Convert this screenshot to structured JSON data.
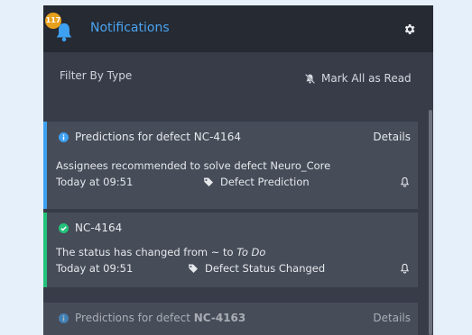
{
  "header": {
    "badge_count": "117",
    "title": "Notifications",
    "icons": {
      "bell": "bell-icon",
      "settings": "gear-icon"
    }
  },
  "filter": {
    "label": "Filter By Type",
    "mark_all_read": "Mark All as Read",
    "mark_all_icon": "bell-slash-icon"
  },
  "notifications": [
    {
      "title_prefix": "Predictions for defect",
      "title_id": "NC-4164",
      "details_label": "Details",
      "message": "Assignees recommended to solve defect Neuro_Core",
      "time": "Today at 09:51",
      "type": "Defect Prediction",
      "status_icon": "info-circle-icon",
      "accent": "#3ea0f0"
    },
    {
      "title_id": "NC-4164",
      "message_prefix": "The status has changed from ~ to",
      "message_emph": "To Do",
      "time": "Today at 09:51",
      "type": "Defect Status Changed",
      "status_icon": "check-circle-icon",
      "accent": "#23c27a"
    },
    {
      "title_prefix": "Predictions for defect",
      "title_id": "NC-4163",
      "details_label": "Details",
      "status_icon": "info-circle-icon",
      "accent": "#3ea0f0"
    }
  ],
  "colors": {
    "panel_bg": "#383c49",
    "header_bg": "#252a33",
    "card_bg": "#464c58",
    "title_blue": "#4aa3f0",
    "badge": "#e8a11c",
    "page_bg": "#e6f0fb"
  }
}
